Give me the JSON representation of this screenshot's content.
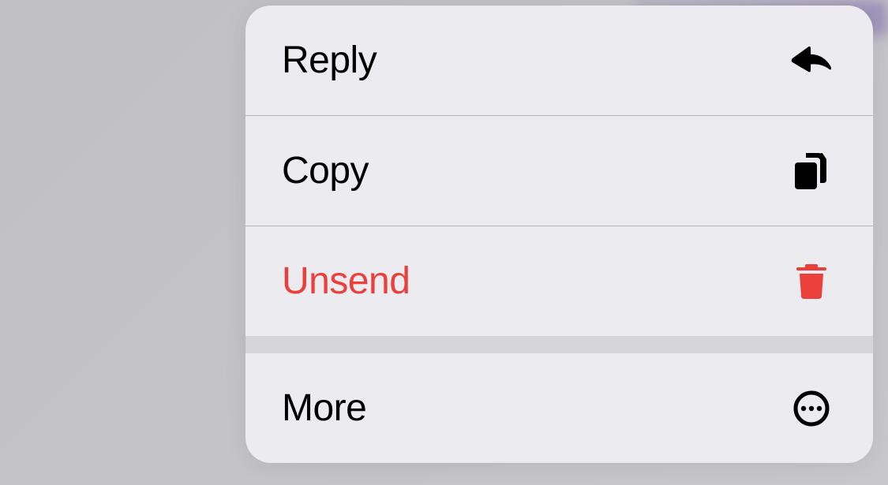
{
  "context_menu": {
    "items": [
      {
        "label": "Reply",
        "icon": "reply-icon",
        "destructive": false
      },
      {
        "label": "Copy",
        "icon": "copy-icon",
        "destructive": false
      },
      {
        "label": "Unsend",
        "icon": "trash-icon",
        "destructive": true
      },
      {
        "label": "More",
        "icon": "more-icon",
        "destructive": false
      }
    ]
  },
  "colors": {
    "destructive": "#ea3f3a",
    "text": "#000000",
    "menu_bg": "#ecebef",
    "divider": "#b7b6ba",
    "thick_divider": "#d5d4d8"
  }
}
